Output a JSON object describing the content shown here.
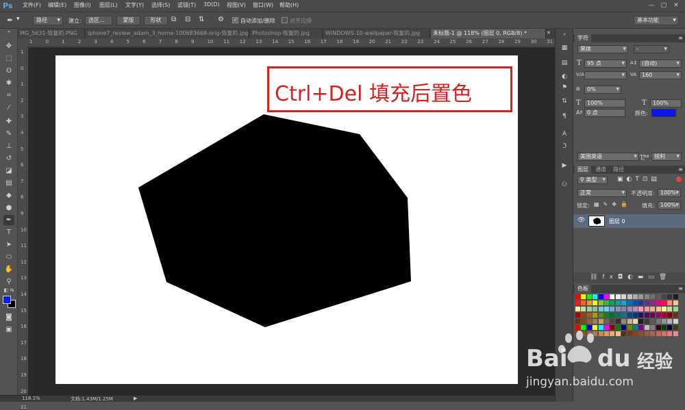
{
  "app": {
    "logo": "Ps"
  },
  "menu": [
    "文件(F)",
    "编辑(E)",
    "图像(I)",
    "图层(L)",
    "文字(Y)",
    "选择(S)",
    "滤镜(T)",
    "3D(D)",
    "视图(V)",
    "窗口(W)",
    "帮助(H)"
  ],
  "window_buttons": [
    "—",
    "▢",
    "✕"
  ],
  "options": {
    "mode": "路径",
    "build_label": "建立:",
    "selection_btn": "选区...",
    "mask_btn": "蒙版",
    "shape_btn": "形状",
    "auto_add_delete": "自动添加/删除",
    "align_edges": "对齐边缘",
    "workspace": "基本功能"
  },
  "doc_tabs": [
    "MG_5631-恢复的.PNG",
    "iphone7_review_adam_3_home-100683668-orig-恢复的.jpg",
    "Photoshop-恢复的.jpg",
    "WINDOWS-10-wallpaper-恢复的.jpg",
    "未标题-1 @ 118% (图层 0, RGB/8) *"
  ],
  "ruler_top": [
    "1",
    "0",
    "1",
    "2",
    "3",
    "4",
    "5",
    "6",
    "7",
    "8",
    "9",
    "10",
    "11",
    "12",
    "13",
    "14",
    "15",
    "16",
    "17",
    "18",
    "19",
    "20",
    "21",
    "22",
    "23",
    "24",
    "25",
    "26",
    "27",
    "28",
    "29",
    "30",
    "31"
  ],
  "ruler_left": [
    "1",
    "0",
    "1",
    "2",
    "3",
    "4",
    "5",
    "6",
    "7",
    "8",
    "9",
    "10",
    "11",
    "12",
    "13",
    "14",
    "15",
    "16",
    "17",
    "18",
    "19",
    "20",
    "21"
  ],
  "annotation": "Ctrl+Del 填充后置色",
  "colors": {
    "foreground": "#0a1aff",
    "background": "#000000",
    "annotation": "#d42020",
    "shape": "#000000"
  },
  "character_panel": {
    "tab": "字符",
    "font": "黑体",
    "style": "-",
    "size": "95 点",
    "leading": "(自动)",
    "kerning": "",
    "tracking": "160",
    "scale_pct": "0%",
    "vscale": "100%",
    "hscale": "100%",
    "baseline": "0 点",
    "color_label": "颜色:",
    "color": "#0a14ee",
    "styles": [
      "T",
      "T",
      "TT",
      "Tr",
      "T'",
      "T,",
      "T",
      "T"
    ],
    "ligatures": [
      "fi",
      "σ",
      "st",
      "A",
      "ād",
      "T",
      "1st",
      "½"
    ],
    "language": "美国英语",
    "aa_label": "aa",
    "aa": "锐利"
  },
  "layers_panel": {
    "tabs": [
      "图层",
      "通道",
      "路径"
    ],
    "filter": "类型",
    "blend_mode": "正常",
    "opacity_label": "不透明度:",
    "opacity": "100%",
    "lock_label": "锁定:",
    "fill_label": "填充:",
    "fill": "100%",
    "layer_name": "图层 0",
    "layer_number": "0"
  },
  "swatches_panel": {
    "tab": "色板"
  },
  "status": {
    "zoom": "118.1%",
    "doc": "文档:1.43M/1.25M"
  },
  "watermark": {
    "brand": "Bai",
    "brand2": "du",
    "suffix": "经验",
    "url": "jingyan.baidu.com"
  }
}
